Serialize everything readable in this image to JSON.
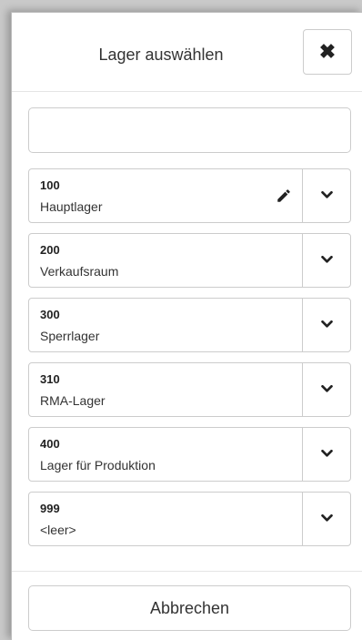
{
  "dialog": {
    "title": "Lager auswählen",
    "close_symbol": "✖"
  },
  "search": {
    "value": "",
    "placeholder": ""
  },
  "warehouses": [
    {
      "code": "100",
      "name": "Hauptlager",
      "editable": true
    },
    {
      "code": "200",
      "name": "Verkaufsraum",
      "editable": false
    },
    {
      "code": "300",
      "name": "Sperrlager",
      "editable": false
    },
    {
      "code": "310",
      "name": "RMA-Lager",
      "editable": false
    },
    {
      "code": "400",
      "name": "Lager für Produktion",
      "editable": false
    },
    {
      "code": "999",
      "name": "<leer>",
      "editable": false
    }
  ],
  "icons": {
    "close": "close-icon",
    "edit": "pencil-icon",
    "expand": "chevron-down-icon"
  },
  "footer": {
    "cancel_label": "Abbrechen"
  }
}
